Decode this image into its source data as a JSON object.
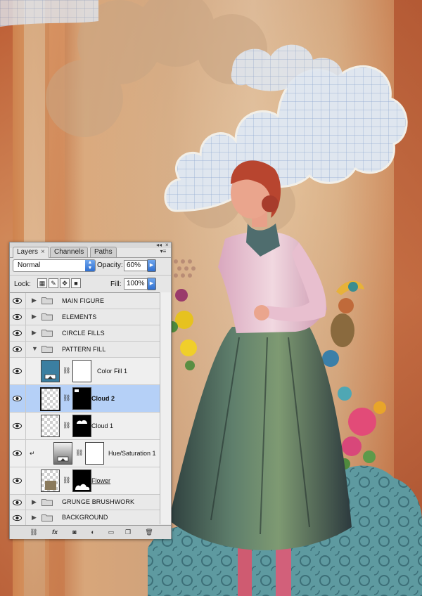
{
  "panel": {
    "tabs": [
      {
        "label": "Layers",
        "active": true
      },
      {
        "label": "Channels",
        "active": false
      },
      {
        "label": "Paths",
        "active": false
      }
    ],
    "tab_close_glyph": "×",
    "blend_mode": "Normal",
    "opacity_label": "Opacity:",
    "opacity_value": "60%",
    "lock_label": "Lock:",
    "fill_label": "Fill:",
    "fill_value": "100%",
    "layers": [
      {
        "type": "group",
        "name": "MAIN FIGURE",
        "expanded": false
      },
      {
        "type": "group",
        "name": "ELEMENTS",
        "expanded": false
      },
      {
        "type": "group",
        "name": "CIRCLE FILLS",
        "expanded": false
      },
      {
        "type": "group",
        "name": "PATTERN FILL",
        "expanded": true
      },
      {
        "type": "layer",
        "name": "Color Fill 1",
        "fill_color": "#3b7fa1"
      },
      {
        "type": "layer",
        "name": "Cloud 2",
        "selected": true
      },
      {
        "type": "layer",
        "name": "Cloud 1"
      },
      {
        "type": "layer",
        "name": "Hue/Saturation 1",
        "clipped": true
      },
      {
        "type": "layer",
        "name": "Flower",
        "swatch_color": "#8a7a5c"
      },
      {
        "type": "group",
        "name": "GRUNGE BRUSHWORK",
        "expanded": false
      },
      {
        "type": "group",
        "name": "BACKGROUND",
        "expanded": false
      }
    ],
    "footer_buttons": [
      "link-layers",
      "fx",
      "add-mask",
      "adjustment",
      "new-group",
      "new-layer",
      "delete"
    ],
    "fx_label": "fx"
  },
  "colors": {
    "selection": "#b5d0f7",
    "accent_blue": "#2f6fcf",
    "paper": "#d6b090",
    "teal_pattern": "#5e9aa0",
    "skirt": "#4d6b63"
  }
}
